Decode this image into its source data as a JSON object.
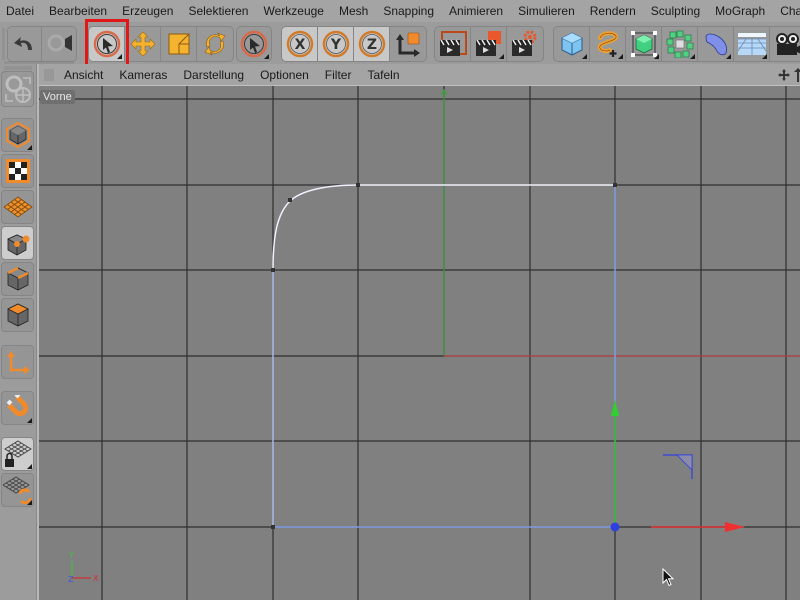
{
  "menubar": {
    "items": [
      "Datei",
      "Bearbeiten",
      "Erzeugen",
      "Selektieren",
      "Werkzeuge",
      "Mesh",
      "Snapping",
      "Animieren",
      "Simulieren",
      "Rendern",
      "Sculpting",
      "MoGraph",
      "Charak"
    ]
  },
  "toolbar": {
    "groups": [
      {
        "name": "history",
        "buttons": [
          {
            "icon": "undo-icon"
          },
          {
            "icon": "redo-icon",
            "disabled": true
          }
        ]
      },
      {
        "name": "tools",
        "buttons": [
          {
            "icon": "live-selection-icon",
            "active": true,
            "highlighted": true
          },
          {
            "icon": "move-icon"
          },
          {
            "icon": "scale-icon"
          },
          {
            "icon": "rotate-icon"
          }
        ]
      },
      {
        "name": "selection",
        "buttons": [
          {
            "icon": "selection-tool-icon"
          }
        ]
      },
      {
        "name": "axes",
        "buttons": [
          {
            "icon": "x-axis-lock-icon",
            "label": "X"
          },
          {
            "icon": "y-axis-lock-icon",
            "label": "Y"
          },
          {
            "icon": "z-axis-lock-icon",
            "label": "Z"
          },
          {
            "icon": "coordinate-system-icon"
          }
        ]
      },
      {
        "name": "render",
        "buttons": [
          {
            "icon": "render-view-icon"
          },
          {
            "icon": "render-picture-viewer-icon"
          },
          {
            "icon": "render-settings-icon"
          }
        ]
      },
      {
        "name": "objects",
        "buttons": [
          {
            "icon": "cube-icon"
          },
          {
            "icon": "spline-pen-icon"
          },
          {
            "icon": "subdivision-surface-icon"
          },
          {
            "icon": "cloner-icon"
          },
          {
            "icon": "deformer-icon"
          },
          {
            "icon": "floor-icon"
          },
          {
            "icon": "camera-icon"
          }
        ]
      }
    ]
  },
  "left_toolbar": {
    "buttons": [
      {
        "icon": "make-editable-icon"
      },
      {
        "icon": "texture-mode-icon"
      },
      {
        "icon": "workplane-icon"
      },
      {
        "icon": "points-mode-icon",
        "active": true
      },
      {
        "icon": "edges-mode-icon"
      },
      {
        "icon": "polygons-mode-icon"
      },
      {
        "icon": "axis-mode-icon"
      },
      {
        "icon": "snapping-magnet-icon"
      },
      {
        "icon": "workplane-lock-icon"
      },
      {
        "icon": "grid-align-icon"
      }
    ]
  },
  "viewport": {
    "menu": [
      "Ansicht",
      "Kameras",
      "Darstellung",
      "Optionen",
      "Filter",
      "Tafeln"
    ],
    "label": "Vorne",
    "axis_labels": {
      "y": "Y",
      "x": "X",
      "z": "Z"
    },
    "colors": {
      "background": "#808080",
      "grid": "#2f2f2f",
      "spline": "#f0f0ff",
      "spline_selected": "#8aa8ff",
      "x_axis": "#e03030",
      "y_axis": "#30c030",
      "z_axis": "#3040e0",
      "highlight": "#e01818"
    }
  }
}
